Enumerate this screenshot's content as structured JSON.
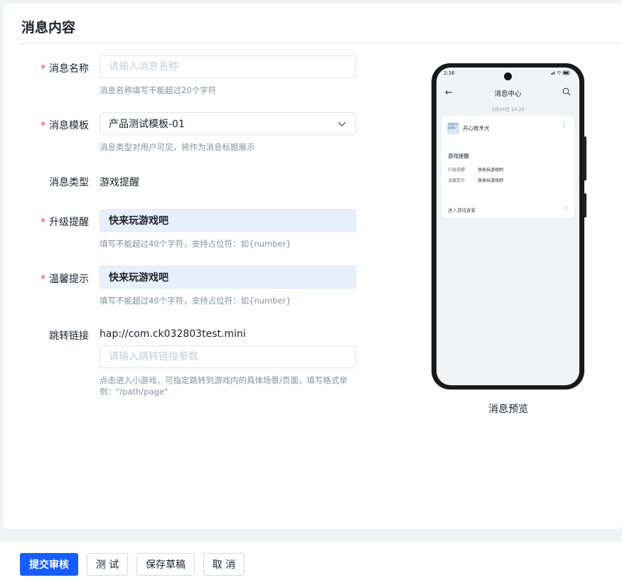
{
  "card": {
    "title": "消息内容"
  },
  "form": {
    "name": {
      "label": "消息名称",
      "placeholder": "请输入消息名称",
      "hint": "消息名称填写不能超过20个字符"
    },
    "template": {
      "label": "消息模板",
      "value": "产品测试模板-01",
      "hint": "消息类型对用户可见，将作为消息标题展示"
    },
    "type": {
      "label": "消息类型",
      "value": "游戏提醒"
    },
    "upgrade": {
      "label": "升级提醒",
      "value": "快来玩游戏吧",
      "hint": "填写不能超过40个字符，支持占位符：如{number}"
    },
    "tip": {
      "label": "温馨提示",
      "value": "快来玩游戏吧",
      "hint": "填写不能超过40个字符，支持占位符：如{number}"
    },
    "link": {
      "label": "跳转链接",
      "prefix": "hap://com.ck032803test.mini",
      "placeholder": "请输入跳转链接参数",
      "hint": "点击进入小游戏，可指定跳转到游戏内的具体场景/页面，填写格式举例：\"/path/page\""
    },
    "required_mark": "*"
  },
  "preview": {
    "status_time": "2:36",
    "nav_title": "消息中心",
    "time": "3月24日 14:20",
    "app_icon_text": "长测试小游戏测",
    "app_name": "开心牧羊犬",
    "msg_title": "游戏提醒",
    "rows": [
      {
        "k": "升级提醒",
        "v": "快来玩游戏吧"
      },
      {
        "k": "温馨提示",
        "v": "快来玩游戏吧"
      }
    ],
    "link_text": "进入游戏查看",
    "label": "消息预览"
  },
  "footer": {
    "submit": "提交审核",
    "test": "测 试",
    "save": "保存草稿",
    "cancel": "取 消"
  },
  "colors": {
    "primary": "#165dff",
    "required": "#f53f3f",
    "filled_bg": "#e8f0fd"
  }
}
